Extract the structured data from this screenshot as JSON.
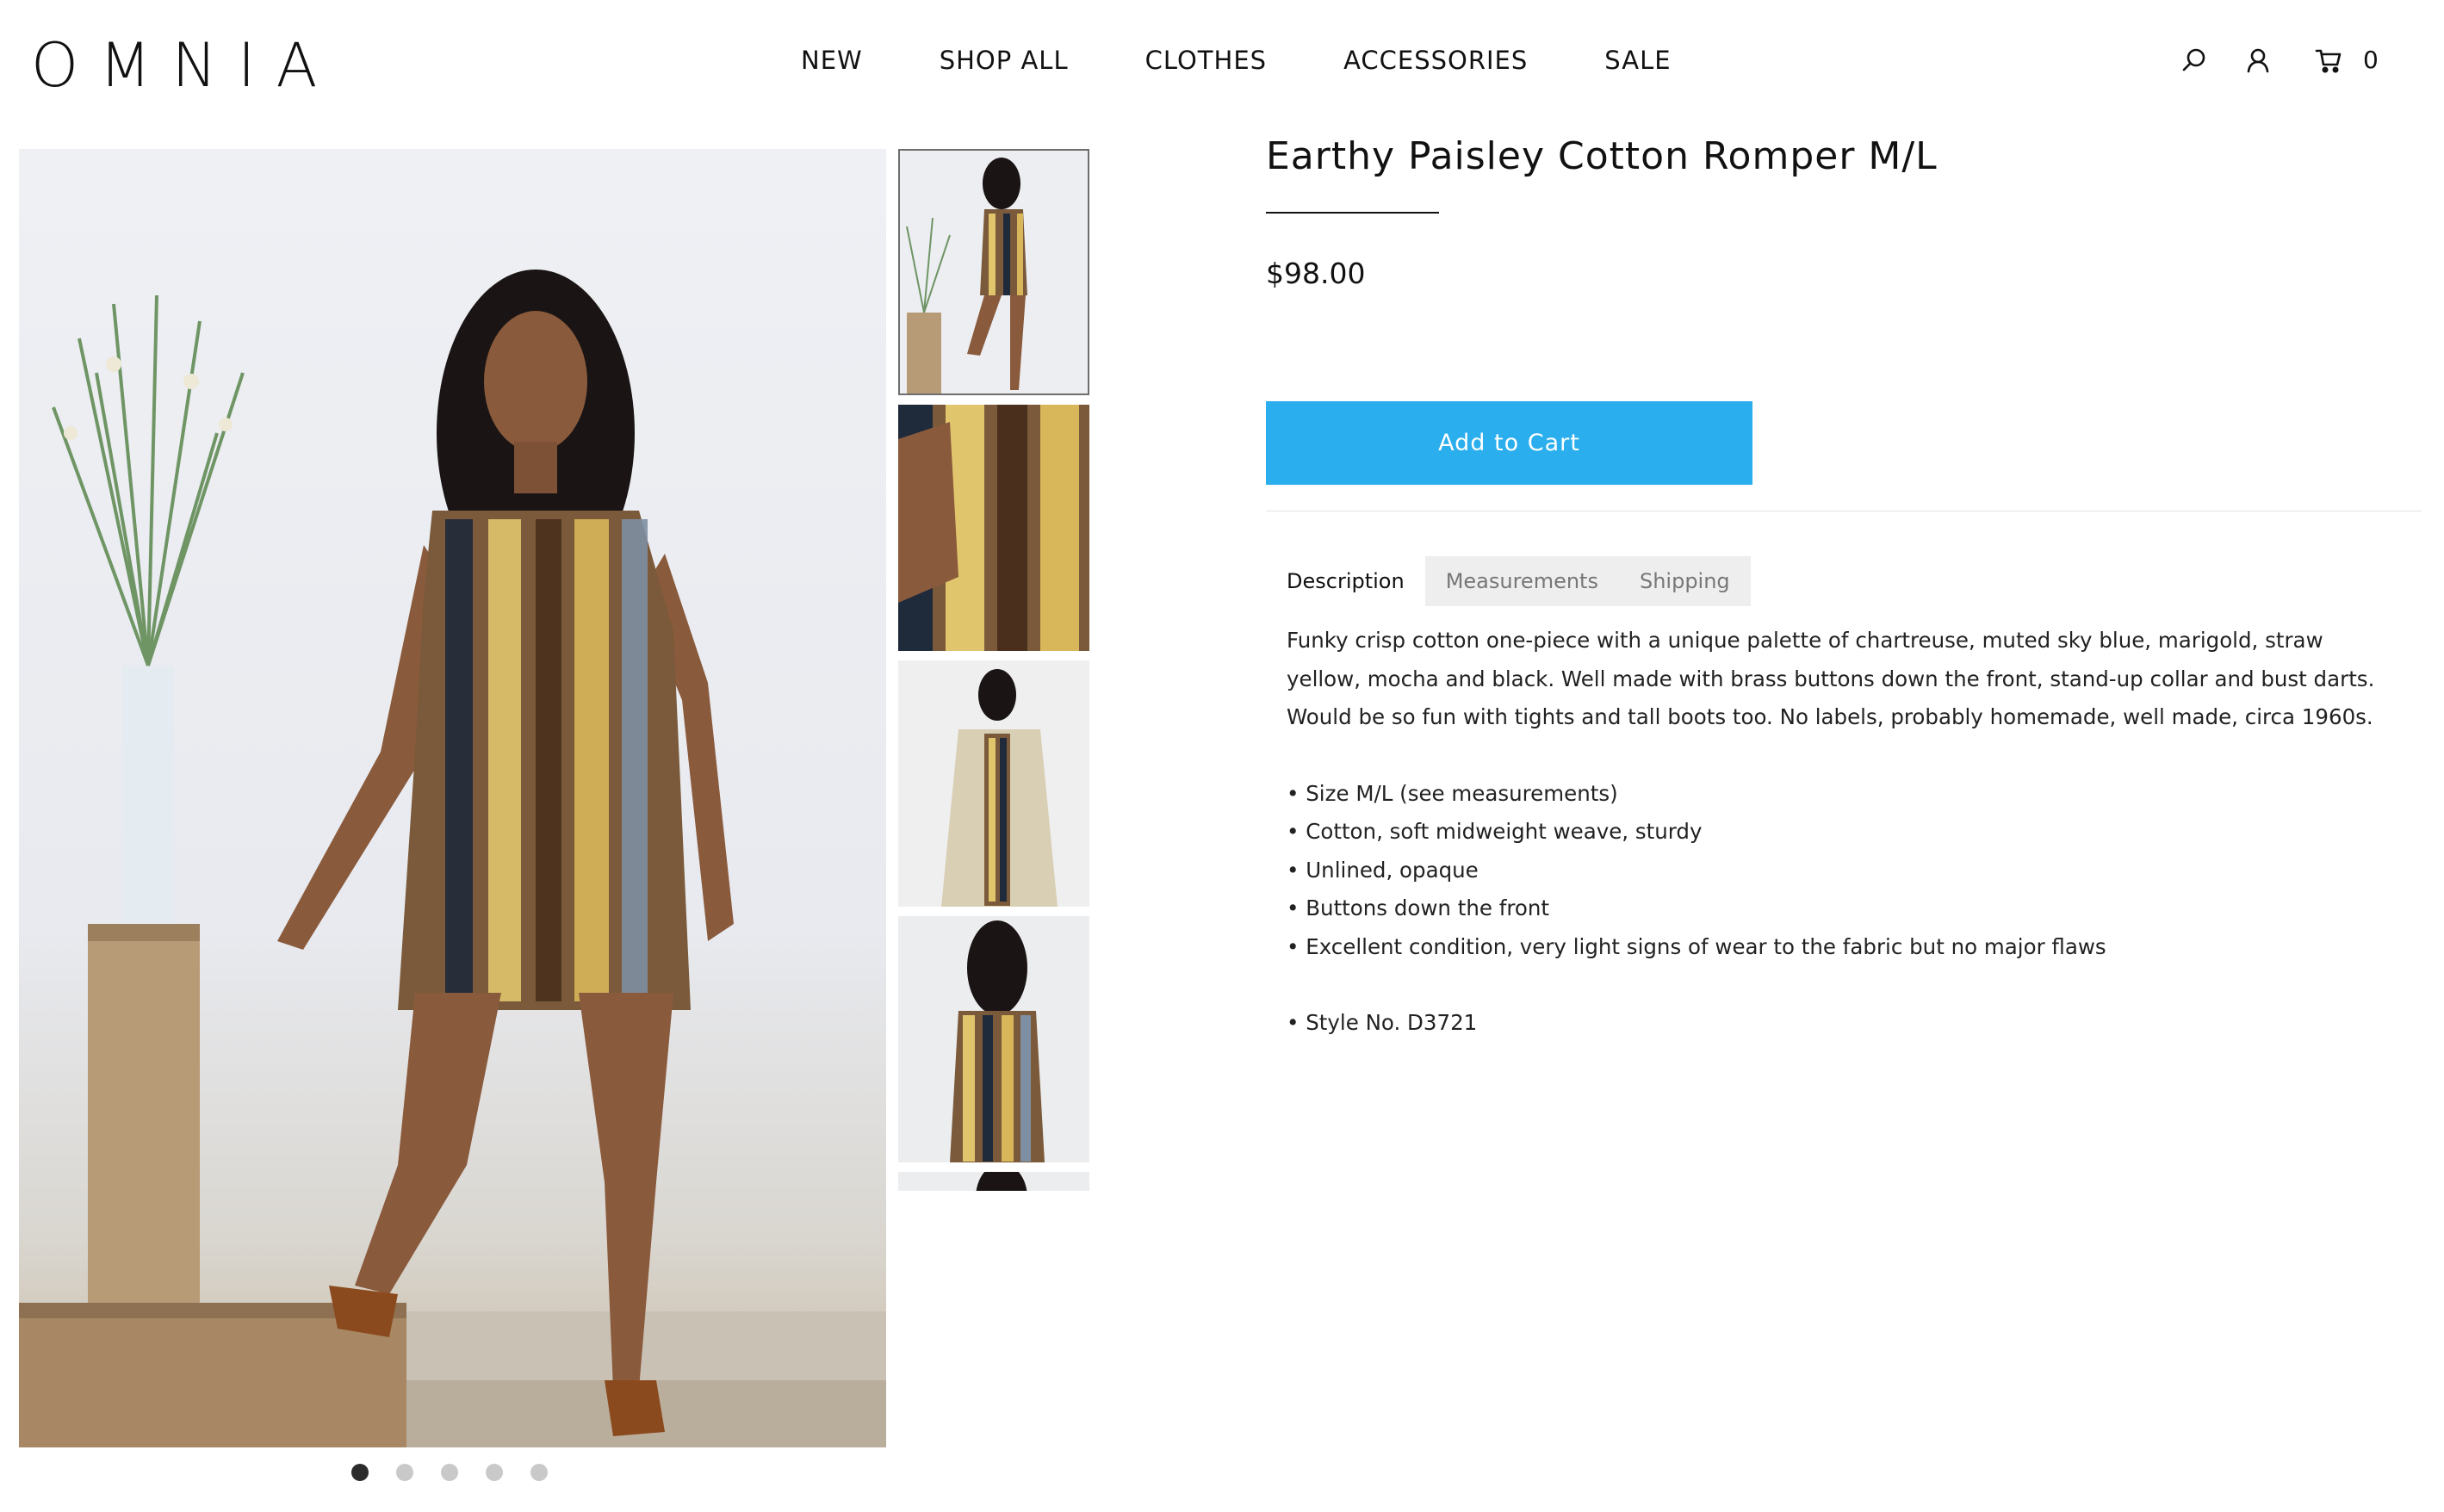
{
  "brand": {
    "logo": "OMNIA"
  },
  "nav": {
    "items": [
      "NEW",
      "SHOP ALL",
      "CLOTHES",
      "ACCESSORIES",
      "SALE"
    ]
  },
  "header_icons": {
    "search": "search-icon",
    "account": "account-icon",
    "cart": "cart-icon",
    "cart_count": "0"
  },
  "product": {
    "title": "Earthy Paisley Cotton Romper M/L",
    "price": "$98.00",
    "add_to_cart_label": "Add to Cart"
  },
  "tabs": [
    {
      "label": "Description",
      "active": true
    },
    {
      "label": "Measurements",
      "active": false
    },
    {
      "label": "Shipping",
      "active": false
    }
  ],
  "description": {
    "paragraph": "Funky crisp cotton one-piece with a unique palette of chartreuse, muted sky blue, marigold, straw yellow, mocha and black. Well made with brass buttons down the front, stand-up collar and bust darts. Would be so fun with tights and tall boots too. No labels, probably homemade, well made, circa 1960s.",
    "bullets": [
      "• Size M/L (see measurements)",
      "• Cotton, soft midweight weave, sturdy",
      "• Unlined, opaque",
      "• Buttons down the front",
      "• Excellent condition, very light signs of wear to the fabric but no major flaws"
    ],
    "style_no": "• Style No. D3721"
  },
  "gallery": {
    "thumbnail_count": 5,
    "active_index": 0,
    "dots": 5
  },
  "colors": {
    "accent": "#2aaeed",
    "text": "#111111",
    "tab_inactive_bg": "#eeeeee",
    "dot_active": "#2c2c2c",
    "dot_inactive": "#c9c9c9"
  }
}
